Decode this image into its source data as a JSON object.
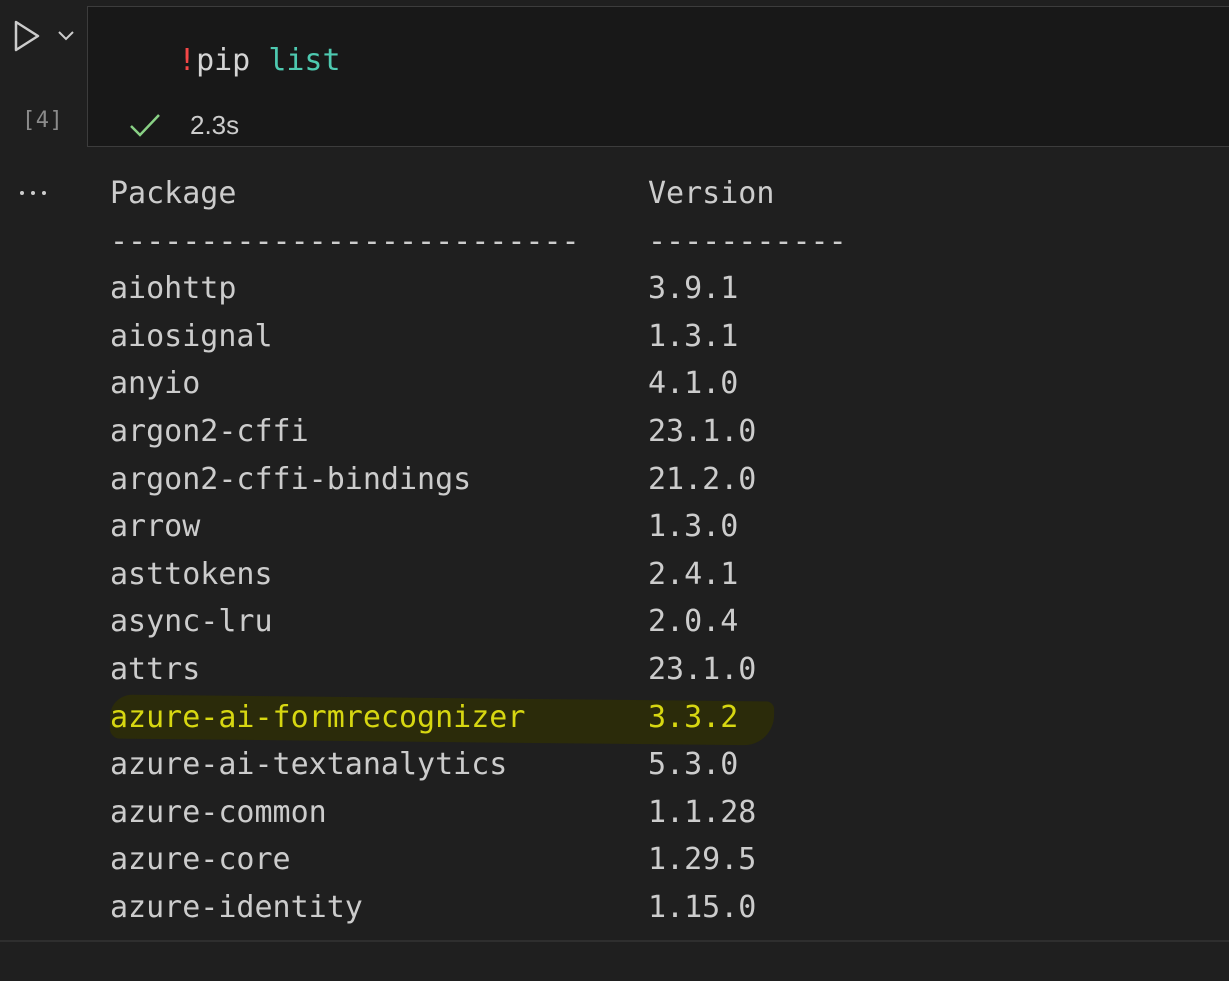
{
  "cell": {
    "execution_count": "[4]",
    "code": {
      "bang": "!",
      "command": "pip",
      "argument": "list"
    },
    "status": {
      "icon": "check-icon",
      "duration": "2.3s"
    },
    "icons": {
      "run": "play-icon",
      "run_menu": "chevron-down-icon",
      "output_menu": "ellipsis-icon"
    }
  },
  "output": {
    "header": {
      "package": "Package",
      "version": "Version"
    },
    "separator": {
      "package": "--------------------------",
      "version": "-----------"
    },
    "rows": [
      {
        "package": "aiohttp",
        "version": "3.9.1"
      },
      {
        "package": "aiosignal",
        "version": "1.3.1"
      },
      {
        "package": "anyio",
        "version": "4.1.0"
      },
      {
        "package": "argon2-cffi",
        "version": "23.1.0"
      },
      {
        "package": "argon2-cffi-bindings",
        "version": "21.2.0"
      },
      {
        "package": "arrow",
        "version": "1.3.0"
      },
      {
        "package": "asttokens",
        "version": "2.4.1"
      },
      {
        "package": "async-lru",
        "version": "2.0.4"
      },
      {
        "package": "attrs",
        "version": "23.1.0"
      },
      {
        "package": "azure-ai-formrecognizer",
        "version": "3.3.2",
        "highlighted": true
      },
      {
        "package": "azure-ai-textanalytics",
        "version": "5.3.0"
      },
      {
        "package": "azure-common",
        "version": "1.1.28"
      },
      {
        "package": "azure-core",
        "version": "1.29.5"
      },
      {
        "package": "azure-identity",
        "version": "1.15.0"
      }
    ]
  },
  "colors": {
    "background": "#1f1f1f",
    "editor_background": "#181818",
    "highlight_text": "#d7d711",
    "highlight_marker": "#2b2b0a",
    "success_check": "#89d185",
    "bang": "#f44747",
    "argument": "#4ec9b0"
  }
}
